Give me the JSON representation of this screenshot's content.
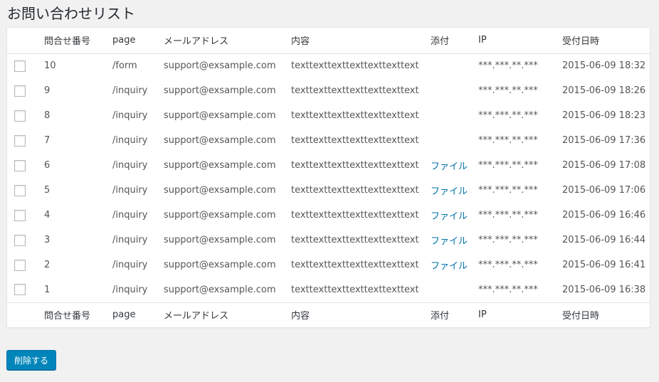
{
  "page": {
    "title": "お問い合わせリスト"
  },
  "table": {
    "columns": [
      "問合せ番号",
      "page",
      "メールアドレス",
      "内容",
      "添付",
      "IP",
      "受付日時"
    ],
    "rows": [
      {
        "num": "10",
        "page": "/form",
        "email": "support@exsample.com",
        "content": "texttexttexttexttexttexttext",
        "attachment": "",
        "ip": "***.***.**.***",
        "date": "2015-06-09 18:32"
      },
      {
        "num": "9",
        "page": "/inquiry",
        "email": "support@exsample.com",
        "content": "texttexttexttexttexttexttext",
        "attachment": "",
        "ip": "***.***.**.***",
        "date": "2015-06-09 18:26"
      },
      {
        "num": "8",
        "page": "/inquiry",
        "email": "support@exsample.com",
        "content": "texttexttexttexttexttexttext",
        "attachment": "",
        "ip": "***.***.**.***",
        "date": "2015-06-09 18:23"
      },
      {
        "num": "7",
        "page": "/inquiry",
        "email": "support@exsample.com",
        "content": "texttexttexttexttexttexttext",
        "attachment": "",
        "ip": "***.***.**.***",
        "date": "2015-06-09 17:36"
      },
      {
        "num": "6",
        "page": "/inquiry",
        "email": "support@exsample.com",
        "content": "texttexttexttexttexttexttext",
        "attachment": "ファイル",
        "ip": "***.***.**.***",
        "date": "2015-06-09 17:08"
      },
      {
        "num": "5",
        "page": "/inquiry",
        "email": "support@exsample.com",
        "content": "texttexttexttexttexttexttext",
        "attachment": "ファイル",
        "ip": "***.***.**.***",
        "date": "2015-06-09 17:06"
      },
      {
        "num": "4",
        "page": "/inquiry",
        "email": "support@exsample.com",
        "content": "texttexttexttexttexttexttext",
        "attachment": "ファイル",
        "ip": "***.***.**.***",
        "date": "2015-06-09 16:46"
      },
      {
        "num": "3",
        "page": "/inquiry",
        "email": "support@exsample.com",
        "content": "texttexttexttexttexttexttext",
        "attachment": "ファイル",
        "ip": "***.***.**.***",
        "date": "2015-06-09 16:44"
      },
      {
        "num": "2",
        "page": "/inquiry",
        "email": "support@exsample.com",
        "content": "texttexttexttexttexttexttext",
        "attachment": "ファイル",
        "ip": "***.***.**.***",
        "date": "2015-06-09 16:41"
      },
      {
        "num": "1",
        "page": "/inquiry",
        "email": "support@exsample.com",
        "content": "texttexttexttexttexttexttext",
        "attachment": "",
        "ip": "***.***.**.***",
        "date": "2015-06-09 16:38"
      }
    ]
  },
  "actions": {
    "delete_label": "削除する"
  },
  "colors": {
    "link": "#0073aa",
    "button": "#0085ba",
    "background": "#f1f1f1"
  }
}
